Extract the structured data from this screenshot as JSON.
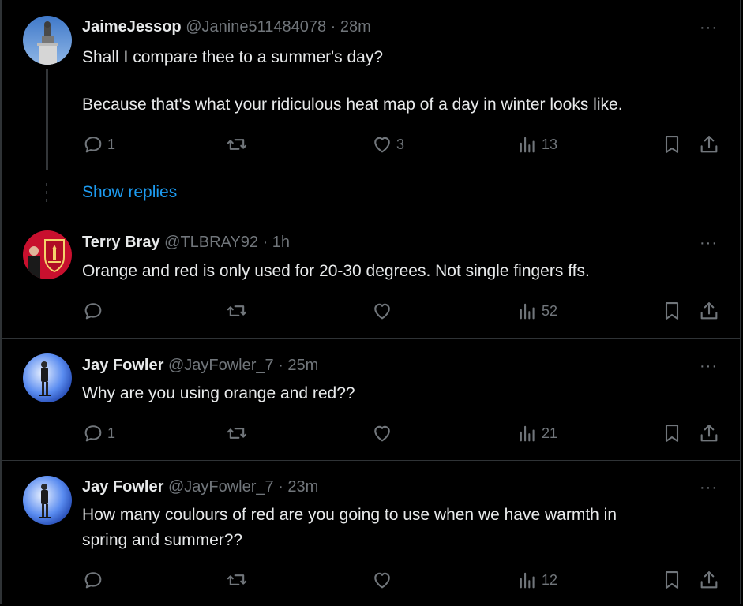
{
  "tweets": [
    {
      "name": "JaimeJessop",
      "handle": "@Janine511484078",
      "time": "· 28m",
      "lines": [
        "Shall I compare thee to a summer's day?",
        "Because that's what your ridiculous heat map of a day in winter looks like."
      ],
      "replies": "1",
      "retweets": "",
      "likes": "3",
      "views": "13",
      "show_replies": "Show replies",
      "avatar": "statue-avatar"
    },
    {
      "name": "Terry Bray",
      "handle": "@TLBRAY92",
      "time": "· 1h",
      "lines": [
        "Orange and red is only used for 20-30 degrees. Not single fingers ffs."
      ],
      "replies": "",
      "retweets": "",
      "likes": "",
      "views": "52",
      "avatar": "liverpool-crest-avatar"
    },
    {
      "name": "Jay Fowler",
      "handle": "@JayFowler_7",
      "time": "· 25m",
      "lines": [
        "Why are you using orange and red??"
      ],
      "replies": "1",
      "retweets": "",
      "likes": "",
      "views": "21",
      "avatar": "ice-skater-avatar"
    },
    {
      "name": "Jay Fowler",
      "handle": "@JayFowler_7",
      "time": "· 23m",
      "lines": [
        "How many coulours of red are you going to use when we have warmth in",
        "spring and summer??"
      ],
      "replies": "",
      "retweets": "",
      "likes": "",
      "views": "12",
      "avatar": "ice-skater-avatar"
    }
  ],
  "more_glyph": "···",
  "colors": {
    "background": "#000000",
    "text": "#e7e9ea",
    "muted": "#71767b",
    "link": "#1d9bf0",
    "border": "#2f3336"
  }
}
